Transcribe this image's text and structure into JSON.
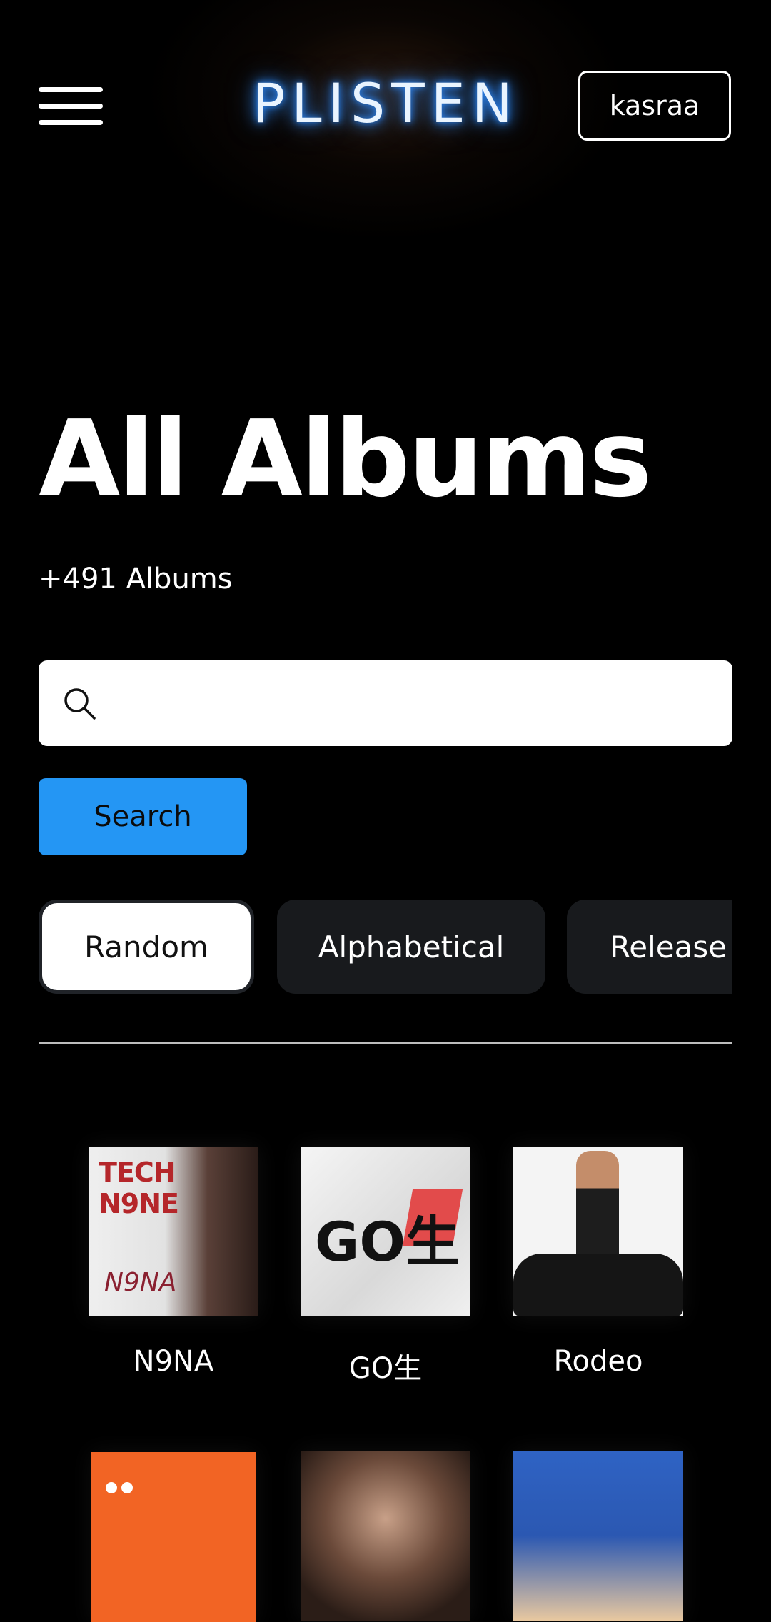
{
  "header": {
    "logo": "PLISTEN",
    "user_button": "kasraa",
    "menu_icon": "hamburger-menu-icon"
  },
  "page": {
    "title": "All Albums",
    "count": "+491 Albums"
  },
  "search": {
    "placeholder": "",
    "value": "",
    "button_label": "Search",
    "icon": "search-icon"
  },
  "sort_tabs": [
    {
      "label": "Random",
      "active": true
    },
    {
      "label": "Alphabetical",
      "active": false
    },
    {
      "label": "Release Date",
      "active": false
    }
  ],
  "albums": [
    {
      "title": "N9NA",
      "cover_text": "TECH N9NE",
      "cover_sub": "N9NA"
    },
    {
      "title": "GO生",
      "cover_text": "GO生",
      "cover_sub": ""
    },
    {
      "title": "Rodeo",
      "cover_text": "",
      "cover_sub": ""
    },
    {
      "title": "",
      "cover_text": "",
      "cover_sub": ""
    },
    {
      "title": "",
      "cover_text": "",
      "cover_sub": ""
    },
    {
      "title": "",
      "cover_text": "",
      "cover_sub": ""
    }
  ],
  "colors": {
    "accent": "#2496f4",
    "background": "#000000",
    "tab_inactive": "#181a1d",
    "logo_glow": "#2e8cff"
  }
}
